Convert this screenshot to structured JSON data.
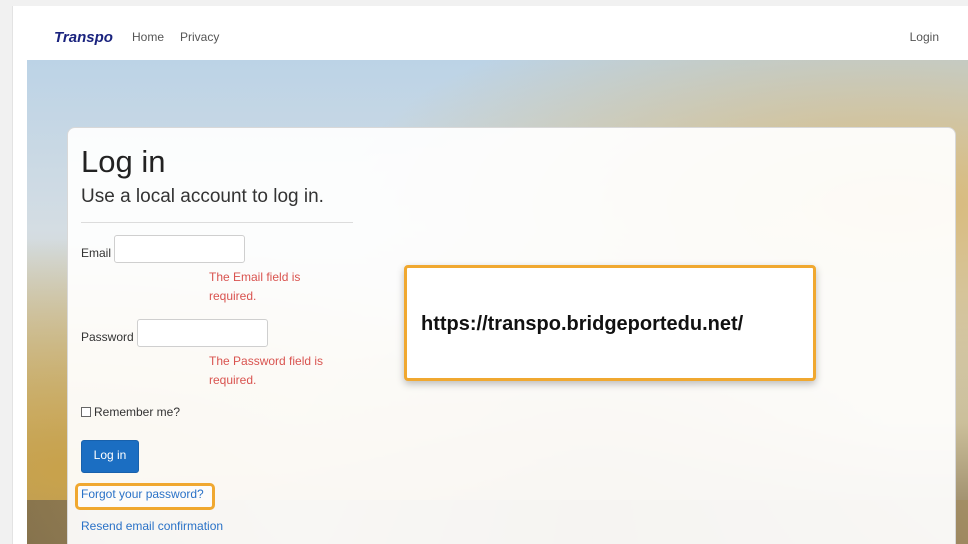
{
  "navbar": {
    "brand": "Transpo",
    "home": "Home",
    "privacy": "Privacy",
    "login": "Login"
  },
  "form": {
    "title": "Log in",
    "subtitle": "Use a local account to log in.",
    "email_label": "Email",
    "email_value": "",
    "email_error": "The Email field is required.",
    "password_label": "Password",
    "password_value": "",
    "password_error": "The Password field is required.",
    "remember_label": "Remember me?",
    "submit_label": "Log in",
    "forgot_link": "Forgot your password?",
    "resend_link": "Resend email confirmation"
  },
  "callout": {
    "url": "https://transpo.bridgeportedu.net/"
  },
  "colors": {
    "brand": "#1a237e",
    "primary": "#1b6ec2",
    "error": "#d9534f",
    "highlight": "#f0a830",
    "link": "#2a72c7"
  }
}
